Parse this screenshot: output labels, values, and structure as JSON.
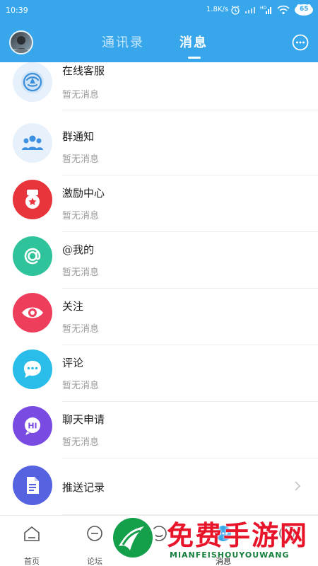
{
  "status_bar": {
    "time": "10:39",
    "speed": "1.8K/s",
    "battery": "65"
  },
  "nav": {
    "tabs": [
      "通讯录",
      "消息"
    ],
    "active_tab": 1
  },
  "messages": [
    {
      "title": "在线客服",
      "subtitle": "暂无消息",
      "icon": "customer-service-icon",
      "color": "#e6f1fb"
    },
    {
      "title": "群通知",
      "subtitle": "暂无消息",
      "icon": "group-icon",
      "color": "#e6f1fb"
    },
    {
      "title": "激励中心",
      "subtitle": "暂无消息",
      "icon": "award-icon",
      "color": "#e8353b"
    },
    {
      "title": "@我的",
      "subtitle": "暂无消息",
      "icon": "at-icon",
      "color": "#2ec39a"
    },
    {
      "title": "关注",
      "subtitle": "暂无消息",
      "icon": "eye-icon",
      "color": "#ee3e5c"
    },
    {
      "title": "评论",
      "subtitle": "暂无消息",
      "icon": "comment-icon",
      "color": "#2bbde9"
    },
    {
      "title": "聊天申请",
      "subtitle": "暂无消息",
      "icon": "hi-icon",
      "color": "#7a4be3"
    },
    {
      "title": "推送记录",
      "subtitle": "",
      "icon": "document-icon",
      "color": "#5563e0"
    }
  ],
  "tabbar": {
    "items": [
      {
        "label": "首页",
        "icon": "home-icon"
      },
      {
        "label": "论坛",
        "icon": "forum-icon"
      },
      {
        "label": "",
        "icon": "smile-icon"
      },
      {
        "label": "消息",
        "icon": "message-icon"
      },
      {
        "label": "",
        "icon": "user-icon"
      }
    ],
    "active": 3
  },
  "watermark": {
    "text": "免费手游网",
    "sub": "MIANFEISHOUYOUWANG"
  }
}
